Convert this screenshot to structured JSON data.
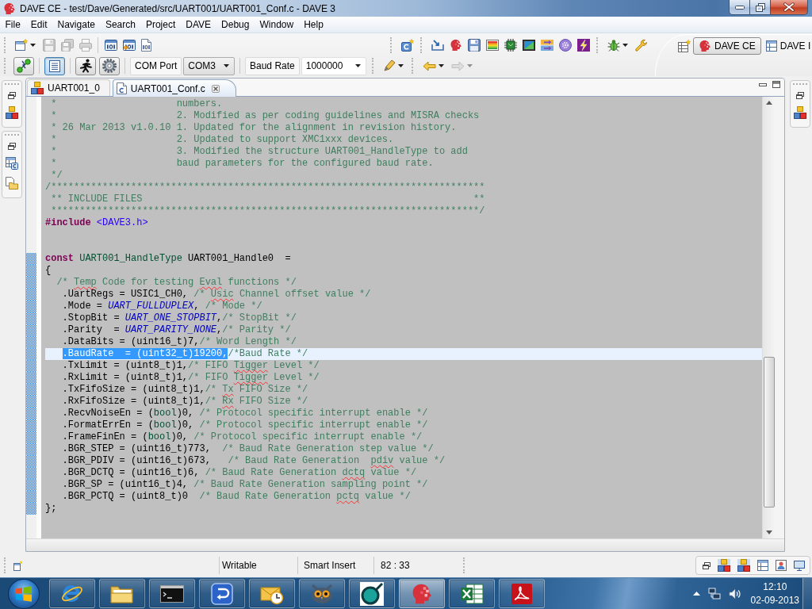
{
  "window": {
    "title": "DAVE CE - test/Dave/Generated/src/UART001/UART001_Conf.c - DAVE 3"
  },
  "menu": [
    "File",
    "Edit",
    "Navigate",
    "Search",
    "Project",
    "DAVE",
    "Debug",
    "Window",
    "Help"
  ],
  "toolbar": {
    "file_actions": [
      {
        "disabled": false
      },
      {
        "disabled": true
      },
      {
        "disabled": true
      },
      {
        "disabled": true
      }
    ],
    "view_toggles": [
      {
        "on": false
      },
      {
        "on": true
      },
      {
        "on": false
      },
      {
        "on": false
      }
    ],
    "com_port": {
      "label": "COM Port",
      "value": "COM3",
      "editable": false
    },
    "baud_rate": {
      "label": "Baud Rate",
      "value": "1000000",
      "editable": true
    },
    "history": [
      {
        "disabled": false
      },
      {
        "disabled": true
      }
    ]
  },
  "perspectives": [
    {
      "label": "DAVE CE",
      "selected": true
    },
    {
      "label": "DAVE I",
      "selected": false
    }
  ],
  "editor": {
    "tabs": [
      {
        "label": "UART001_0",
        "kind": "app",
        "selected": false
      },
      {
        "label": "UART001_Conf.c",
        "kind": "source",
        "selected": true
      }
    ],
    "lines": [
      {
        "changed": false,
        "current": false,
        "tokens": [
          {
            "kind": "comment",
            "text": " *                     numbers."
          }
        ]
      },
      {
        "changed": false,
        "current": false,
        "tokens": [
          {
            "kind": "comment",
            "text": " *                     2. Modified as per coding guidelines and MISRA checks"
          }
        ]
      },
      {
        "changed": false,
        "current": false,
        "tokens": [
          {
            "kind": "comment",
            "text": " * 26 Mar 2013 v1.0.10 1. Updated for the alignment in revision history."
          }
        ]
      },
      {
        "changed": false,
        "current": false,
        "tokens": [
          {
            "kind": "comment",
            "text": " *                     2. Updated to support XMC1xxx devices."
          }
        ]
      },
      {
        "changed": false,
        "current": false,
        "tokens": [
          {
            "kind": "comment",
            "text": " *                     3. Modified the structure UART001_HandleType to add"
          }
        ]
      },
      {
        "changed": false,
        "current": false,
        "tokens": [
          {
            "kind": "comment",
            "text": " *                     baud parameters for the configured baud rate."
          }
        ]
      },
      {
        "changed": false,
        "current": false,
        "tokens": [
          {
            "kind": "comment",
            "text": " */"
          }
        ]
      },
      {
        "changed": false,
        "current": false,
        "tokens": [
          {
            "kind": "comment",
            "text": "/****************************************************************************"
          }
        ]
      },
      {
        "changed": false,
        "current": false,
        "tokens": [
          {
            "kind": "comment",
            "text": " ** INCLUDE FILES                                                          **"
          }
        ]
      },
      {
        "changed": false,
        "current": false,
        "tokens": [
          {
            "kind": "comment",
            "text": " ***************************************************************************/"
          }
        ]
      },
      {
        "changed": false,
        "current": false,
        "tokens": [
          {
            "kind": "keyword",
            "text": "#include"
          },
          {
            "kind": "include",
            "text": " <DAVE3.h>"
          }
        ]
      },
      {
        "changed": false,
        "current": false
      },
      {
        "changed": false,
        "current": false
      },
      {
        "changed": true,
        "current": false,
        "tokens": [
          {
            "kind": "keyword",
            "text": "const"
          },
          {
            "kind": "type",
            "text": " UART001_HandleType"
          },
          {
            "kind": "plain",
            "text": " UART001_Handle0  ="
          }
        ]
      },
      {
        "changed": true,
        "current": false,
        "tokens": [
          {
            "kind": "plain",
            "text": "{"
          }
        ]
      },
      {
        "changed": true,
        "current": false,
        "tokens": [
          {
            "kind": "comment",
            "text": "  /* "
          },
          {
            "kind": "misspelled",
            "text": "Temp"
          },
          {
            "kind": "comment",
            "text": " Code for testing "
          },
          {
            "kind": "misspelled",
            "text": "Eval"
          },
          {
            "kind": "comment",
            "text": " functions */"
          }
        ]
      },
      {
        "changed": true,
        "current": false,
        "tokens": [
          {
            "kind": "plain",
            "text": "   .UartRegs = USIC1_CH0, "
          },
          {
            "kind": "comment",
            "text": "/* "
          },
          {
            "kind": "misspelled",
            "text": "Usic"
          },
          {
            "kind": "comment",
            "text": " Channel offset value */"
          }
        ]
      },
      {
        "changed": true,
        "current": false,
        "tokens": [
          {
            "kind": "plain",
            "text": "   .Mode = "
          },
          {
            "kind": "constant",
            "text": "UART_FULLDUPLEX"
          },
          {
            "kind": "plain",
            "text": ", "
          },
          {
            "kind": "comment",
            "text": "/* Mode */"
          }
        ]
      },
      {
        "changed": true,
        "current": false,
        "tokens": [
          {
            "kind": "plain",
            "text": "   .StopBit = "
          },
          {
            "kind": "constant",
            "text": "UART_ONE_STOPBIT"
          },
          {
            "kind": "plain",
            "text": ","
          },
          {
            "kind": "comment",
            "text": "/* StopBit */"
          }
        ]
      },
      {
        "changed": true,
        "current": false,
        "tokens": [
          {
            "kind": "plain",
            "text": "   .Parity  = "
          },
          {
            "kind": "constant",
            "text": "UART_PARITY_NONE"
          },
          {
            "kind": "plain",
            "text": ","
          },
          {
            "kind": "comment",
            "text": "/* Parity */"
          }
        ]
      },
      {
        "changed": true,
        "current": false,
        "tokens": [
          {
            "kind": "plain",
            "text": "   .DataBits = (uint16_t)7,"
          },
          {
            "kind": "comment",
            "text": "/* Word Length */"
          }
        ]
      },
      {
        "changed": true,
        "current": true,
        "tokens": [
          {
            "kind": "selection",
            "text": "   .BaudRate  = (uint32_t)19200,"
          },
          {
            "kind": "comment",
            "text": "/*Baud Rate */"
          }
        ]
      },
      {
        "changed": true,
        "current": false,
        "tokens": [
          {
            "kind": "plain",
            "text": "   .TxLimit = (uint8_t)1,"
          },
          {
            "kind": "comment",
            "text": "/* FIFO "
          },
          {
            "kind": "misspelled",
            "text": "Tigger"
          },
          {
            "kind": "comment",
            "text": " Level */"
          }
        ]
      },
      {
        "changed": true,
        "current": false,
        "tokens": [
          {
            "kind": "plain",
            "text": "   .RxLimit = (uint8_t)1,"
          },
          {
            "kind": "comment",
            "text": "/* FIFO "
          },
          {
            "kind": "misspelled",
            "text": "Tigger"
          },
          {
            "kind": "comment",
            "text": " Level */"
          }
        ]
      },
      {
        "changed": true,
        "current": false,
        "tokens": [
          {
            "kind": "plain",
            "text": "   .TxFifoSize = (uint8_t)1,"
          },
          {
            "kind": "comment",
            "text": "/* "
          },
          {
            "kind": "misspelled",
            "text": "Tx"
          },
          {
            "kind": "comment",
            "text": " FIFO Size */"
          }
        ]
      },
      {
        "changed": true,
        "current": false,
        "tokens": [
          {
            "kind": "plain",
            "text": "   .RxFifoSize = (uint8_t)1,"
          },
          {
            "kind": "comment",
            "text": "/* "
          },
          {
            "kind": "misspelled",
            "text": "Rx"
          },
          {
            "kind": "comment",
            "text": " FIFO Size */"
          }
        ]
      },
      {
        "changed": true,
        "current": false,
        "tokens": [
          {
            "kind": "plain",
            "text": "   .RecvNoiseEn = ("
          },
          {
            "kind": "type",
            "text": "bool"
          },
          {
            "kind": "plain",
            "text": ")0, "
          },
          {
            "kind": "comment",
            "text": "/* Protocol specific interrupt enable */"
          }
        ]
      },
      {
        "changed": true,
        "current": false,
        "tokens": [
          {
            "kind": "plain",
            "text": "   .FormatErrEn = ("
          },
          {
            "kind": "type",
            "text": "bool"
          },
          {
            "kind": "plain",
            "text": ")0, "
          },
          {
            "kind": "comment",
            "text": "/* Protocol specific interrupt enable */"
          }
        ]
      },
      {
        "changed": true,
        "current": false,
        "tokens": [
          {
            "kind": "plain",
            "text": "   .FrameFinEn = ("
          },
          {
            "kind": "type",
            "text": "bool"
          },
          {
            "kind": "plain",
            "text": ")0, "
          },
          {
            "kind": "comment",
            "text": "/* Protocol specific interrupt enable */"
          }
        ]
      },
      {
        "changed": true,
        "current": false,
        "tokens": [
          {
            "kind": "plain",
            "text": "   .BGR_STEP = (uint16_t)773,  "
          },
          {
            "kind": "comment",
            "text": "/* Baud Rate Generation step value */"
          }
        ]
      },
      {
        "changed": true,
        "current": false,
        "tokens": [
          {
            "kind": "plain",
            "text": "   .BGR_PDIV = (uint16_t)673,   "
          },
          {
            "kind": "comment",
            "text": "/* Baud Rate Generation  "
          },
          {
            "kind": "misspelled",
            "text": "pdiv"
          },
          {
            "kind": "comment",
            "text": " value */"
          }
        ]
      },
      {
        "changed": true,
        "current": false,
        "tokens": [
          {
            "kind": "plain",
            "text": "   .BGR_DCTQ = (uint16_t)6, "
          },
          {
            "kind": "comment",
            "text": "/* Baud Rate Generation "
          },
          {
            "kind": "misspelled",
            "text": "dctq"
          },
          {
            "kind": "comment",
            "text": " value */"
          }
        ]
      },
      {
        "changed": true,
        "current": false,
        "tokens": [
          {
            "kind": "plain",
            "text": "   .BGR_SP = (uint16_t)4, "
          },
          {
            "kind": "comment",
            "text": "/* Baud Rate Generation sampling point */"
          }
        ]
      },
      {
        "changed": true,
        "current": false,
        "tokens": [
          {
            "kind": "plain",
            "text": "   .BGR_PCTQ = (uint8_t)0  "
          },
          {
            "kind": "comment",
            "text": "/* Baud Rate Generation "
          },
          {
            "kind": "misspelled",
            "text": "pctq"
          },
          {
            "kind": "comment",
            "text": " value */"
          }
        ]
      },
      {
        "changed": true,
        "current": false,
        "tokens": [
          {
            "kind": "plain",
            "text": "};"
          }
        ]
      }
    ]
  },
  "status_bar": {
    "fields": [
      "Writable",
      "Smart Insert",
      "82 : 33"
    ]
  },
  "taskbar": {
    "apps": [
      {
        "selected": false
      },
      {
        "selected": false
      },
      {
        "selected": false
      },
      {
        "selected": false
      },
      {
        "selected": false
      },
      {
        "selected": false
      },
      {
        "selected": false
      },
      {
        "selected": true
      },
      {
        "selected": false
      },
      {
        "selected": false
      }
    ],
    "clock": {
      "time": "12:10",
      "date": "02-09-2013"
    }
  }
}
